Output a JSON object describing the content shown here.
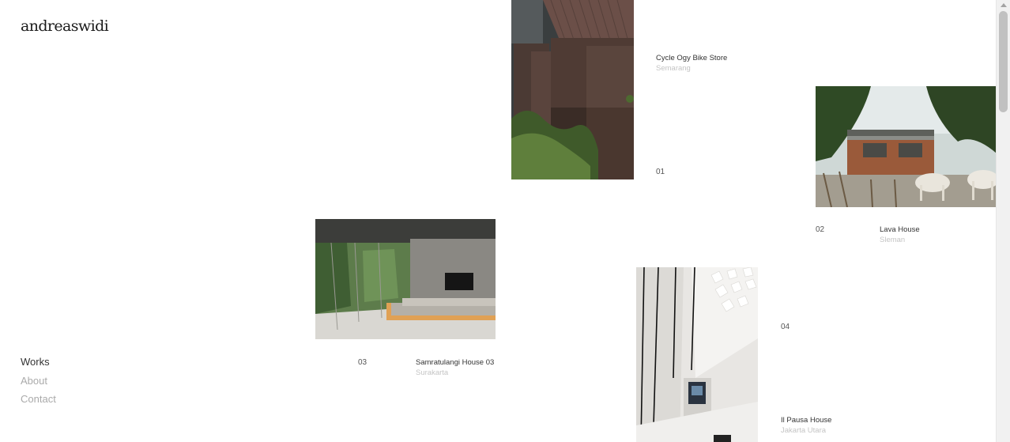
{
  "logo": "andreaswidi",
  "nav": {
    "works": "Works",
    "about": "About",
    "contact": "Contact"
  },
  "projects": [
    {
      "number": "01",
      "title": "Cycle Ogy Bike Store",
      "location": "Semarang"
    },
    {
      "number": "02",
      "title": "Lava House",
      "location": "Sleman"
    },
    {
      "number": "03",
      "title": "Samratulangi House 03",
      "location": "Surakarta"
    },
    {
      "number": "04",
      "title": "Il Pausa House",
      "location": "Jakarta Utara"
    }
  ]
}
